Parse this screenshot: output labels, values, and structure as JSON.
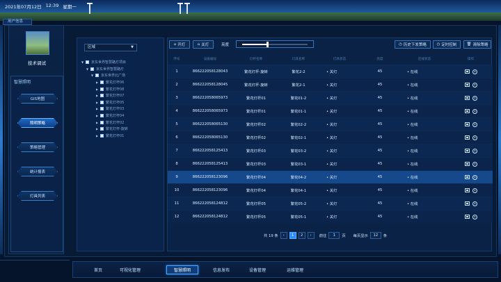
{
  "header": {
    "date": "2021年07月12日",
    "time": "12:39",
    "weekday": "星期一",
    "user_tab": "用户信息"
  },
  "profile": {
    "name": "技术调试"
  },
  "sidebar": {
    "title": "智慧照明",
    "items": [
      {
        "label": "GIS地图"
      },
      {
        "label": "照明策略"
      },
      {
        "label": "策略管理"
      },
      {
        "label": "统计报表"
      },
      {
        "label": "灯具列表"
      }
    ]
  },
  "tree": {
    "region_label": "区域",
    "nodes": [
      {
        "label": "京东世界智慧路灯项目"
      },
      {
        "label": "京东世界智慧路灯"
      },
      {
        "label": "京东世界北广场"
      },
      {
        "label": "繁花灯杆06"
      },
      {
        "label": "繁花灯杆08"
      },
      {
        "label": "繁花灯杆07"
      },
      {
        "label": "繁花灯杆05"
      },
      {
        "label": "繁花灯杆03"
      },
      {
        "label": "繁花灯杆04"
      },
      {
        "label": "繁花灯杆02"
      },
      {
        "label": "繁花灯杆-旋转"
      },
      {
        "label": "繁花灯杆01"
      }
    ]
  },
  "toolbar": {
    "on_label": "开灯",
    "off_label": "关灯",
    "brightness_label": "亮度",
    "brightness_level": 0.38,
    "history_label": "历史下发策略",
    "timer_label": "定时控制",
    "cancel_label": "清除策略"
  },
  "table": {
    "headers": [
      "序号",
      "设备编号",
      "灯杆名称",
      "灯具名称",
      "灯具状态",
      "亮度",
      "在线状态",
      "操作"
    ],
    "rows": [
      {
        "no": "1",
        "id": "866222058128043",
        "pole": "繁花灯杆-旋转",
        "lamp": "繁花2-2",
        "state": "• 关灯",
        "bright": "45",
        "online": "• 在线"
      },
      {
        "no": "2",
        "id": "866222058128045",
        "pole": "繁花灯杆-旋转",
        "lamp": "繁花2-1",
        "state": "• 关灯",
        "bright": "45",
        "online": "• 在线"
      },
      {
        "no": "3",
        "id": "866222058065973",
        "pole": "繁花灯杆01",
        "lamp": "繁花01-2",
        "state": "• 关灯",
        "bright": "45",
        "online": "• 在线"
      },
      {
        "no": "4",
        "id": "866222058065973",
        "pole": "繁花灯杆01",
        "lamp": "繁花01-1",
        "state": "• 关灯",
        "bright": "45",
        "online": "• 在线"
      },
      {
        "no": "5",
        "id": "866222058065130",
        "pole": "繁花灯杆02",
        "lamp": "繁花02-2",
        "state": "• 关灯",
        "bright": "45",
        "online": "• 在线"
      },
      {
        "no": "6",
        "id": "866222058065130",
        "pole": "繁花灯杆02",
        "lamp": "繁花02-1",
        "state": "• 关灯",
        "bright": "45",
        "online": "• 在线"
      },
      {
        "no": "7",
        "id": "866222058125413",
        "pole": "繁花灯杆03",
        "lamp": "繁花03-2",
        "state": "• 关灯",
        "bright": "45",
        "online": "• 在线"
      },
      {
        "no": "8",
        "id": "866222058125413",
        "pole": "繁花灯杆03",
        "lamp": "繁花03-1",
        "state": "• 关灯",
        "bright": "45",
        "online": "• 在线"
      },
      {
        "no": "9",
        "id": "866222058123096",
        "pole": "繁花灯杆04",
        "lamp": "繁花04-2",
        "state": "• 关灯",
        "bright": "45",
        "online": "• 在线"
      },
      {
        "no": "10",
        "id": "866222058123096",
        "pole": "繁花灯杆04",
        "lamp": "繁花04-1",
        "state": "• 关灯",
        "bright": "45",
        "online": "• 在线"
      },
      {
        "no": "11",
        "id": "866222058124812",
        "pole": "繁花灯杆05",
        "lamp": "繁花05-2",
        "state": "• 关灯",
        "bright": "45",
        "online": "• 在线"
      },
      {
        "no": "12",
        "id": "866222058124812",
        "pole": "繁花灯杆05",
        "lamp": "繁花05-1",
        "state": "• 关灯",
        "bright": "45",
        "online": "• 在线"
      }
    ]
  },
  "pager": {
    "total": "共 19 条",
    "prev": "‹",
    "page1": "1",
    "page2": "2",
    "next": "›",
    "goto_label": "前往",
    "goto_value": "1",
    "page_unit": "页",
    "per_page_label": "每页显示",
    "per_page_value": "12",
    "per_page_unit": "条"
  },
  "nav": {
    "items": [
      {
        "label": "首页"
      },
      {
        "label": "可视化管理"
      },
      {
        "label": "智慧照明"
      },
      {
        "label": "信息发布"
      },
      {
        "label": "设备管理"
      },
      {
        "label": "运维管理"
      }
    ]
  },
  "colors": {
    "accent": "#2e8cff",
    "background": "#06142b",
    "panel": "#0a2246",
    "highlight_row": "#16498c"
  }
}
